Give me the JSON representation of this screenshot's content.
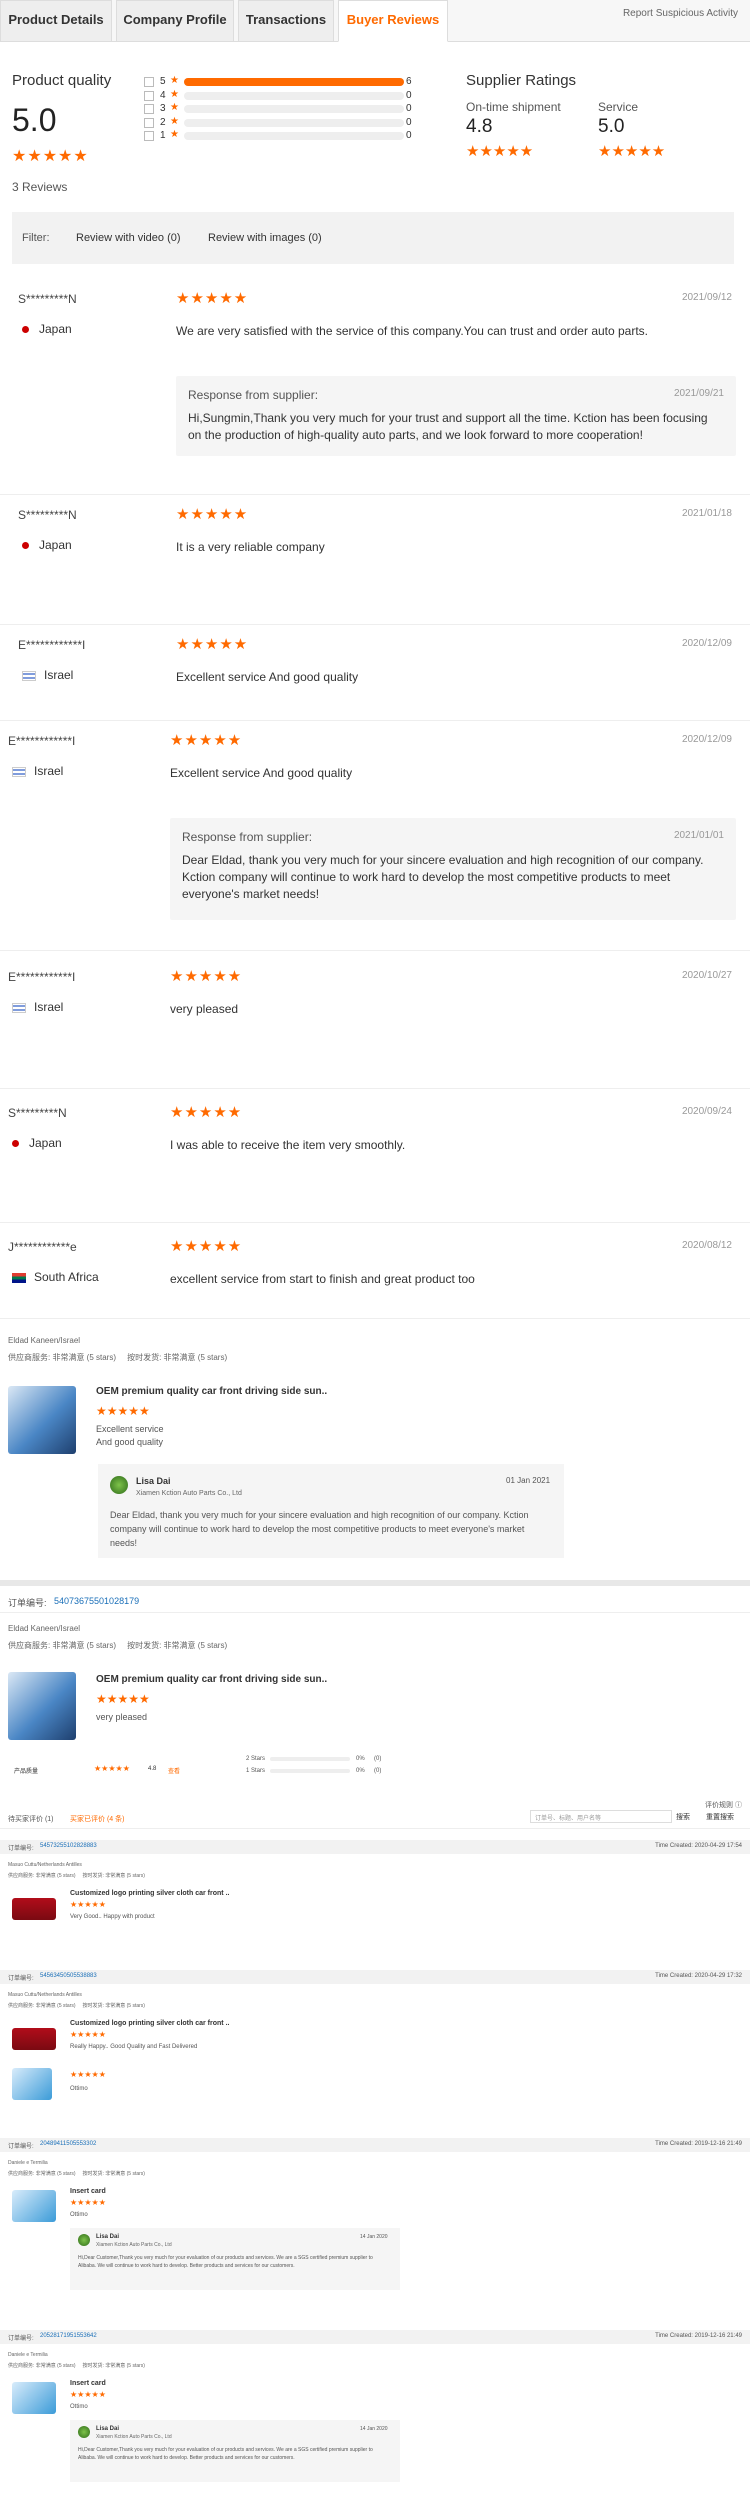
{
  "tabs": {
    "t1": "Product Details",
    "t2": "Company Profile",
    "t3": "Transactions",
    "t4": "Buyer Reviews",
    "report": "Report Suspicious Activity"
  },
  "colors": {
    "accent": "#ff6a00"
  },
  "quality": {
    "label": "Product quality",
    "score": "5.0",
    "stars": "★★★★★",
    "reviews": "3 Reviews"
  },
  "dist": [
    {
      "n": "5",
      "c": "6",
      "fill": 1.0
    },
    {
      "n": "4",
      "c": "0",
      "fill": 0
    },
    {
      "n": "3",
      "c": "0",
      "fill": 0
    },
    {
      "n": "2",
      "c": "0",
      "fill": 0
    },
    {
      "n": "1",
      "c": "0",
      "fill": 0
    }
  ],
  "supplier": {
    "title": "Supplier Ratings",
    "l1": "On-time shipment",
    "v1": "4.8",
    "l2": "Service",
    "v2": "5.0",
    "stars": "★★★★★"
  },
  "filter": {
    "label": "Filter:",
    "f1": "Review with video (0)",
    "f2": "Review with images (0)"
  },
  "reviews": [
    {
      "name": "S*********N",
      "country": "Japan",
      "stars": "★★★★★",
      "date": "2021/09/12",
      "text": "We are very satisfied with the service of this company.You can trust and order auto parts.",
      "resp_label": "Response from supplier:",
      "resp_date": "2021/09/21",
      "resp": "Hi,Sungmin,Thank you very much for your trust and support all the time. Kction has been focusing on the production of high-quality auto parts, and we look forward to more cooperation!"
    },
    {
      "name": "S*********N",
      "country": "Japan",
      "stars": "★★★★★",
      "date": "2021/01/18",
      "text": "It is a very reliable company"
    },
    {
      "name": "E************I",
      "country": "Israel",
      "stars": "★★★★★",
      "date": "2020/12/09",
      "text": "Excellent service And good quality"
    },
    {
      "name": "E************I",
      "country": "Israel",
      "stars": "★★★★★",
      "date": "2020/12/09",
      "text": "Excellent service And good quality",
      "resp_label": "Response from supplier:",
      "resp_date": "2021/01/01",
      "resp": "Dear Eldad, thank you very much for your sincere evaluation and high recognition of our company. Kction company will continue to work hard to develop the most competitive products to meet everyone's market needs!"
    },
    {
      "name": "E************I",
      "country": "Israel",
      "stars": "★★★★★",
      "date": "2020/10/27",
      "text": "very pleased"
    },
    {
      "name": "S*********N",
      "country": "Japan",
      "stars": "★★★★★",
      "date": "2020/09/24",
      "text": "I was able to receive the item very smoothly."
    },
    {
      "name": "J************e",
      "country": "South Africa",
      "stars": "★★★★★",
      "date": "2020/08/12",
      "text": "excellent service from start to finish and great product too"
    }
  ],
  "s1": {
    "user": "Eldad Kaneen/Israel",
    "ratings": "供应商服务: 非常满意 (5 stars)     按时发货: 非常满意 (5 stars)",
    "product": "OEM premium quality car front driving side sun..",
    "stars": "★★★★★",
    "text1": "Excellent service",
    "text2": "And good quality",
    "rep_name": "Lisa Dai",
    "rep_co": "Xiamen Kction Auto Parts Co., Ltd",
    "rep_date": "01 Jan 2021",
    "rep_text": "Dear Eldad, thank you very much for your sincere evaluation and high recognition of our company. Kction company will continue to work hard to develop the most competitive products to meet everyone's market needs!"
  },
  "s2": {
    "order_label": "订单编号:",
    "order": "54073675501028179",
    "user": "Eldad Kaneen/Israel",
    "ratings": "供应商服务: 非常满意 (5 stars)     按时发货: 非常满意 (5 stars)",
    "product": "OEM premium quality car front driving side sun..",
    "stars": "★★★★★",
    "text": "very pleased",
    "rating_label": "产品质量",
    "rating_val": "4.8",
    "rating_link": "查看",
    "d1": "2 Stars",
    "d2": "1 Stars",
    "p1": "0%",
    "p2": "0%",
    "c1": "(0)",
    "c2": "(0)"
  },
  "s3": {
    "tab1": "待买家评价 (1)",
    "tab2": "买家已评价 (4 条)",
    "search": "订单号、标题、用户名等",
    "btn": "搜索",
    "reset": "重置搜索",
    "help": "评价规则 ⓘ"
  },
  "orders": [
    {
      "num_label": "订单编号:",
      "num": "54573255102828883",
      "time": "Time Created: 2020-04-29 17:54",
      "user": "Masuo Cuttu/Netherlands Antilles",
      "r": "供应商服务: 非常满意 (5 stars)     按时发货: 非常满意 (5 stars)",
      "prod": "Customized logo printing silver cloth car front ..",
      "stars": "★★★★★",
      "text": "Very Good.. Happy with product"
    },
    {
      "num_label": "订单编号:",
      "num": "54563450505538883",
      "time": "Time Created: 2020-04-29 17:32",
      "user": "Masuo Cuttu/Netherlands Antilles",
      "r": "供应商服务: 非常满意 (5 stars)     按时发货: 非常满意 (5 stars)",
      "prod": "Customized logo printing silver cloth car front ..",
      "stars": "★★★★★",
      "text": "Really Happy.. Good Quality and Fast Delivered",
      "stars2": "★★★★★",
      "text2": "Ottimo"
    },
    {
      "num_label": "订单编号:",
      "num": "20489411505553302",
      "time": "Time Created: 2019-12-16 21:49",
      "user": "Daniele e Termilia",
      "r": "供应商服务: 非常满意 (5 stars)     按时发货: 非常满意 (5 stars)",
      "prod": "Insert card",
      "stars": "★★★★★",
      "text": "Ottimo",
      "rep_name": "Lisa Dai",
      "rep_co": "Xiamen Kction Auto Parts Co., Ltd",
      "rep_date": "14 Jan 2020",
      "rep_text": "Hi,Dear Customer,Thank you very much for your evaluation of our products and services. We are a SGS certified premium supplier to Alibaba. We will continue to work hard to develop. Better products and services for our customers."
    },
    {
      "num_label": "订单编号:",
      "num": "20528171951553642",
      "time": "Time Created: 2019-12-16 21:49",
      "user": "Daniele e Termilia",
      "r": "供应商服务: 非常满意 (5 stars)     按时发货: 非常满意 (5 stars)",
      "prod": "Insert card",
      "stars": "★★★★★",
      "text": "Ottimo",
      "rep_name": "Lisa Dai",
      "rep_co": "Xiamen Kction Auto Parts Co., Ltd",
      "rep_date": "14 Jan 2020",
      "rep_text": "Hi,Dear Customer,Thank you very much for your evaluation of our products and services. We are a SGS certified premium supplier to Alibaba. We will continue to work hard to develop. Better products and services for our customers."
    }
  ]
}
